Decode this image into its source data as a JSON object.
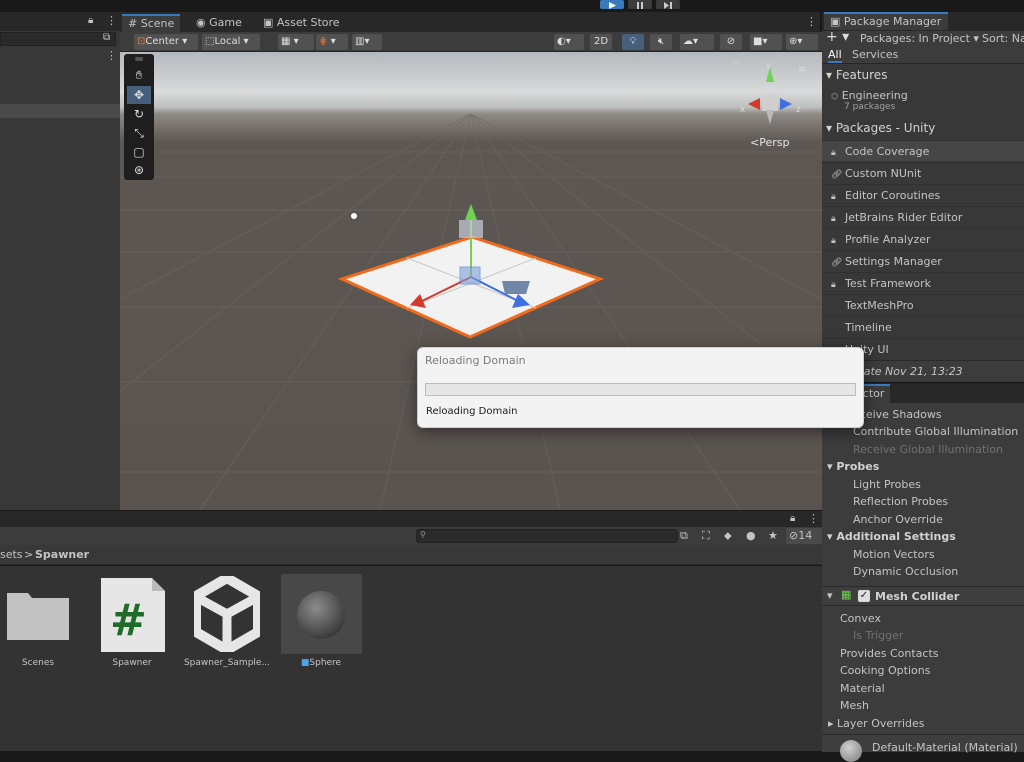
{
  "scene_tabs": {
    "scene": "Scene",
    "game": "Game",
    "asset_store": "Asset Store"
  },
  "scene_toolbar": {
    "pivot_mode": "Center",
    "space_mode": "Local",
    "mode_2d": "2D"
  },
  "viewport": {
    "persp_label": "Persp",
    "gizmo_axes": [
      "x",
      "y",
      "z"
    ]
  },
  "package_manager": {
    "tab_title": "Package Manager",
    "add_label": "+",
    "packages_dropdown": "Packages: In Project",
    "sort_dropdown": "Sort: Na",
    "subtabs": [
      "All",
      "Services"
    ],
    "features_header": "Features",
    "feature_name": "Engineering",
    "feature_count": "7 packages",
    "unity_header": "Packages - Unity",
    "packages": [
      {
        "name": "Code Coverage",
        "icon": "lock-icon",
        "selected": true
      },
      {
        "name": "Custom NUnit",
        "icon": "link-icon",
        "selected": false
      },
      {
        "name": "Editor Coroutines",
        "icon": "lock-icon",
        "selected": false
      },
      {
        "name": "JetBrains Rider Editor",
        "icon": "lock-icon",
        "selected": false
      },
      {
        "name": "Profile Analyzer",
        "icon": "lock-icon",
        "selected": false
      },
      {
        "name": "Settings Manager",
        "icon": "link-icon",
        "selected": false
      },
      {
        "name": "Test Framework",
        "icon": "lock-icon",
        "selected": false
      },
      {
        "name": "TextMeshPro",
        "icon": "",
        "selected": false
      },
      {
        "name": "Timeline",
        "icon": "",
        "selected": false
      },
      {
        "name": "Unity UI",
        "icon": "",
        "selected": false
      }
    ],
    "last_update": "odate Nov 21, 13:23"
  },
  "inspector": {
    "tab_title": "ector",
    "rows": {
      "receive_shadows": "eceive Shadows",
      "contribute_gi": "Contribute Global Illumination",
      "receive_gi": "Receive Global Illumination",
      "probes": "Probes",
      "light_probes": "Light Probes",
      "reflection_probes": "Reflection Probes",
      "anchor_override": "Anchor Override",
      "additional_settings": "Additional Settings",
      "motion_vectors": "Motion Vectors",
      "dynamic_occlusion": "Dynamic Occlusion",
      "mesh_collider": "Mesh Collider",
      "convex": "Convex",
      "is_trigger": "Is Trigger",
      "provides_contacts": "Provides Contacts",
      "cooking_options": "Cooking Options",
      "material": "Material",
      "mesh": "Mesh",
      "layer_overrides": "Layer Overrides",
      "default_material": "Default-Material (Material)"
    }
  },
  "project": {
    "breadcrumb_root": "sets",
    "breadcrumb_sep": ">",
    "breadcrumb_current": "Spawner",
    "hidden_count": "14",
    "assets": [
      {
        "name": "Scenes",
        "icon": "folder-icon"
      },
      {
        "name": "Spawner",
        "icon": "csharp-script-icon"
      },
      {
        "name": "Spawner_Sample...",
        "icon": "unity-logo-icon"
      },
      {
        "name": "Sphere",
        "icon": "sphere-prefab-icon"
      }
    ]
  },
  "dialog": {
    "title": "Reloading Domain",
    "message": "Reloading Domain",
    "progress": 0
  },
  "colors": {
    "accent": "#3a79bb",
    "selection_outline": "#f26b1d",
    "progress_fill": "#06b025"
  }
}
